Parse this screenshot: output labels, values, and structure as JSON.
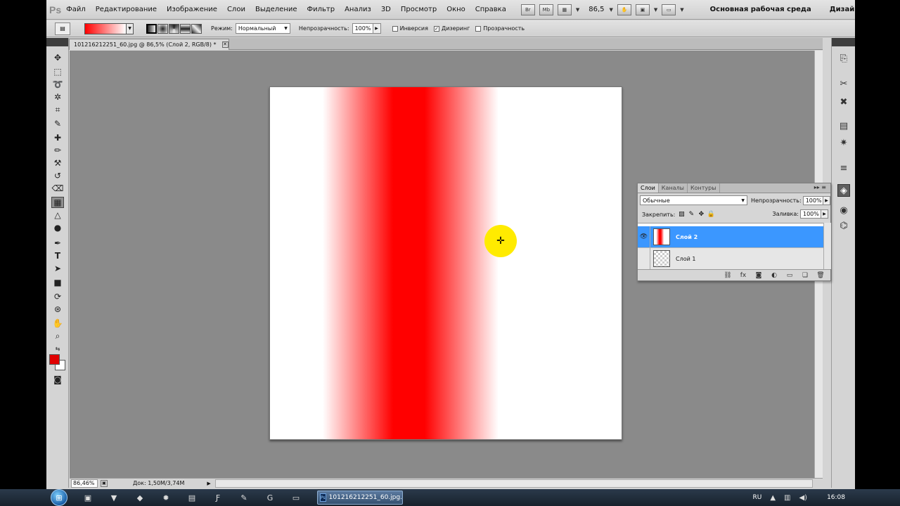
{
  "app": {
    "logo": "Ps",
    "menu": [
      "Файл",
      "Редактирование",
      "Изображение",
      "Слои",
      "Выделение",
      "Фильтр",
      "Анализ",
      "3D",
      "Просмотр",
      "Окно",
      "Справка"
    ],
    "zoom_value": "86,5",
    "workspace": "Основная рабочая среда",
    "design": "Дизайн"
  },
  "options": {
    "mode_label": "Режим:",
    "mode_value": "Нормальный",
    "opacity_label": "Непрозрачность:",
    "opacity_value": "100%",
    "inversion_label": "Инверсия",
    "dither_label": "Дизеринг",
    "transparency_label": "Прозрачность",
    "gradient_start_color": "#ff0000",
    "gradient_end_color": "#ffffff"
  },
  "document": {
    "tab_title": "101216212251_60.jpg @ 86,5% (Слой 2, RGB/8) *",
    "status_zoom": "86,46%",
    "status_doc": "Док: 1,50M/3,74M"
  },
  "layers_panel": {
    "tabs": [
      "Слои",
      "Каналы",
      "Контуры"
    ],
    "blend_mode": "Обычные",
    "opacity_label": "Непрозрачность:",
    "opacity_value": "100%",
    "lock_label": "Закрепить:",
    "fill_label": "Заливка:",
    "fill_value": "100%",
    "layers": [
      {
        "name": "Слой 2",
        "selected": true,
        "visible": true
      },
      {
        "name": "Слой 1",
        "selected": false,
        "visible": false
      }
    ]
  },
  "colors": {
    "foreground": "#e00000",
    "background": "#ffffff",
    "selection": "#3b97ff",
    "cursor_highlight": "#ffeb00"
  },
  "taskbar": {
    "task_title": "101216212251_60.jpg...",
    "language": "RU",
    "clock": "16:08"
  }
}
